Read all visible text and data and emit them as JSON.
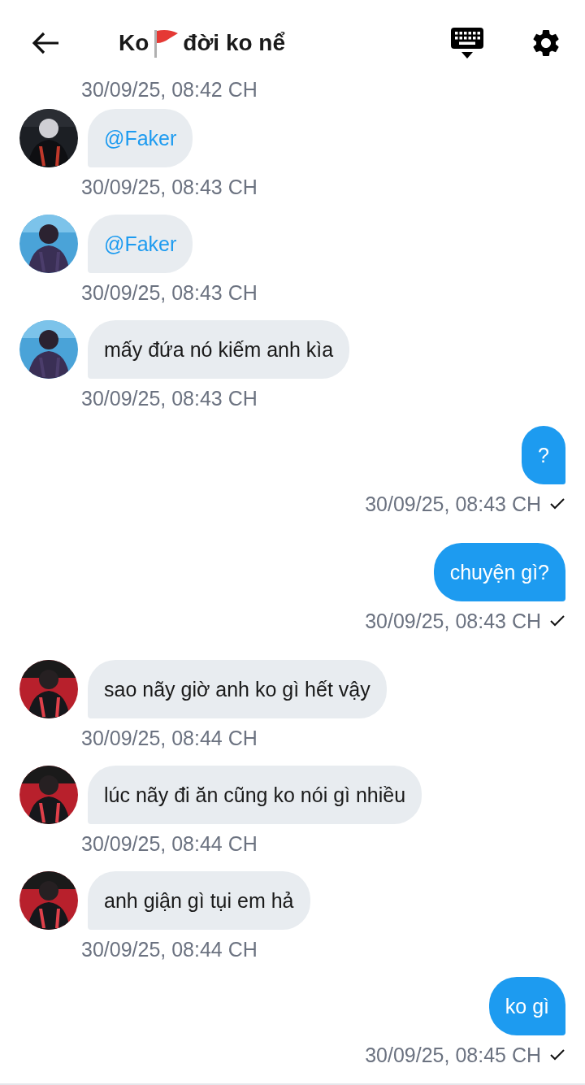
{
  "header": {
    "title_before": "Ko",
    "title_after": "đời ko nể"
  },
  "previous_time": "30/09/25, 08:42 CH",
  "messages": [
    {
      "outgoing": false,
      "kind": "mention",
      "text": "@Faker",
      "time": "30/09/25, 08:43 CH"
    },
    {
      "outgoing": false,
      "kind": "mention",
      "text": "@Faker",
      "time": "30/09/25, 08:43 CH"
    },
    {
      "outgoing": false,
      "kind": "text",
      "text": "mấy đứa nó kiếm anh kìa",
      "time": "30/09/25, 08:43 CH"
    },
    {
      "outgoing": true,
      "kind": "text",
      "text": "?",
      "time": "30/09/25, 08:43 CH",
      "sent": true
    },
    {
      "outgoing": true,
      "kind": "text",
      "text": "chuyện gì?",
      "time": "30/09/25, 08:43 CH",
      "sent": true
    },
    {
      "outgoing": false,
      "kind": "text",
      "text": "sao nãy giờ anh ko gì hết vậy",
      "time": "30/09/25, 08:44 CH"
    },
    {
      "outgoing": false,
      "kind": "text",
      "text": "lúc nãy đi ăn cũng ko nói gì nhiều",
      "time": "30/09/25, 08:44 CH"
    },
    {
      "outgoing": false,
      "kind": "text",
      "text": "anh giận gì tụi em hả",
      "time": "30/09/25, 08:44 CH"
    },
    {
      "outgoing": true,
      "kind": "text",
      "text": "ko gì",
      "time": "30/09/25, 08:45 CH",
      "sent": true
    }
  ]
}
